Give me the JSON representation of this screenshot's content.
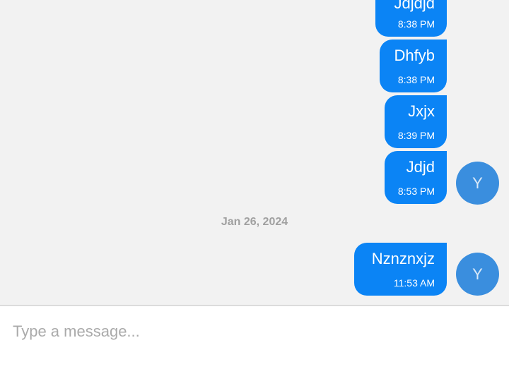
{
  "messages": [
    {
      "text": "Jdjdjd",
      "time": "8:38 PM"
    },
    {
      "text": "Dhfyb",
      "time": "8:38 PM"
    },
    {
      "text": "Jxjx",
      "time": "8:39 PM"
    },
    {
      "text": "Jdjd",
      "time": "8:53 PM"
    },
    {
      "text": "Nznznxjz",
      "time": "11:53 AM"
    }
  ],
  "date_separator": "Jan 26, 2024",
  "avatar_initial": "Y",
  "composer": {
    "placeholder": "Type a message..."
  },
  "colors": {
    "bubble": "#0b84f5",
    "avatar": "#3a8ede",
    "background": "#f2f2f2"
  }
}
